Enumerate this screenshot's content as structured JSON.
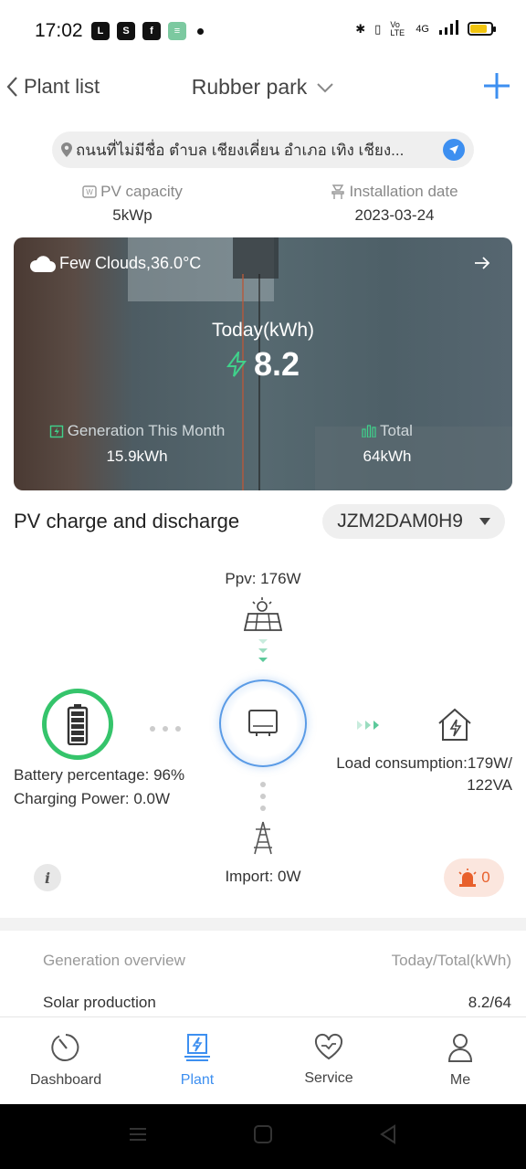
{
  "status_bar": {
    "time": "17:02",
    "signal_label": "4G",
    "volte_label": "Vo LTE"
  },
  "header": {
    "back_label": "Plant list",
    "title": "Rubber park"
  },
  "address": {
    "text": "ถนนที่ไม่มีชื่อ ตำบล เชียงเคี่ยน อำเภอ เทิง เชียง..."
  },
  "info": {
    "pv_capacity_label": "PV capacity",
    "pv_capacity_value": "5kWp",
    "installation_date_label": "Installation date",
    "installation_date_value": "2023-03-24"
  },
  "banner": {
    "weather": "Few Clouds,36.0°C",
    "today_label": "Today(kWh)",
    "today_value": "8.2",
    "month_label": "Generation This Month",
    "month_value": "15.9kWh",
    "total_label": "Total",
    "total_value": "64kWh"
  },
  "pv_section": {
    "title": "PV charge and discharge",
    "device_serial": "JZM2DAM0H9",
    "ppv": "Ppv: 176W",
    "battery_line1": "Battery percentage: 96%",
    "battery_line2": "Charging Power: 0.0W",
    "battery_percent": 96,
    "load_line1": "Load consumption:179W/",
    "load_line2": "122VA",
    "import": "Import: 0W",
    "alarm_count": "0"
  },
  "overview": {
    "title": "Generation overview",
    "unit_label": "Today/Total(kWh)",
    "rows": [
      {
        "label": "Solar production",
        "value": "8.2/64"
      }
    ]
  },
  "tabs": [
    {
      "label": "Dashboard",
      "icon": "dashboard-icon"
    },
    {
      "label": "Plant",
      "icon": "plant-icon",
      "active": true
    },
    {
      "label": "Service",
      "icon": "service-icon"
    },
    {
      "label": "Me",
      "icon": "me-icon"
    }
  ],
  "colors": {
    "accent": "#3d8ff0",
    "green": "#35c46b",
    "alarm": "#e8602c"
  }
}
